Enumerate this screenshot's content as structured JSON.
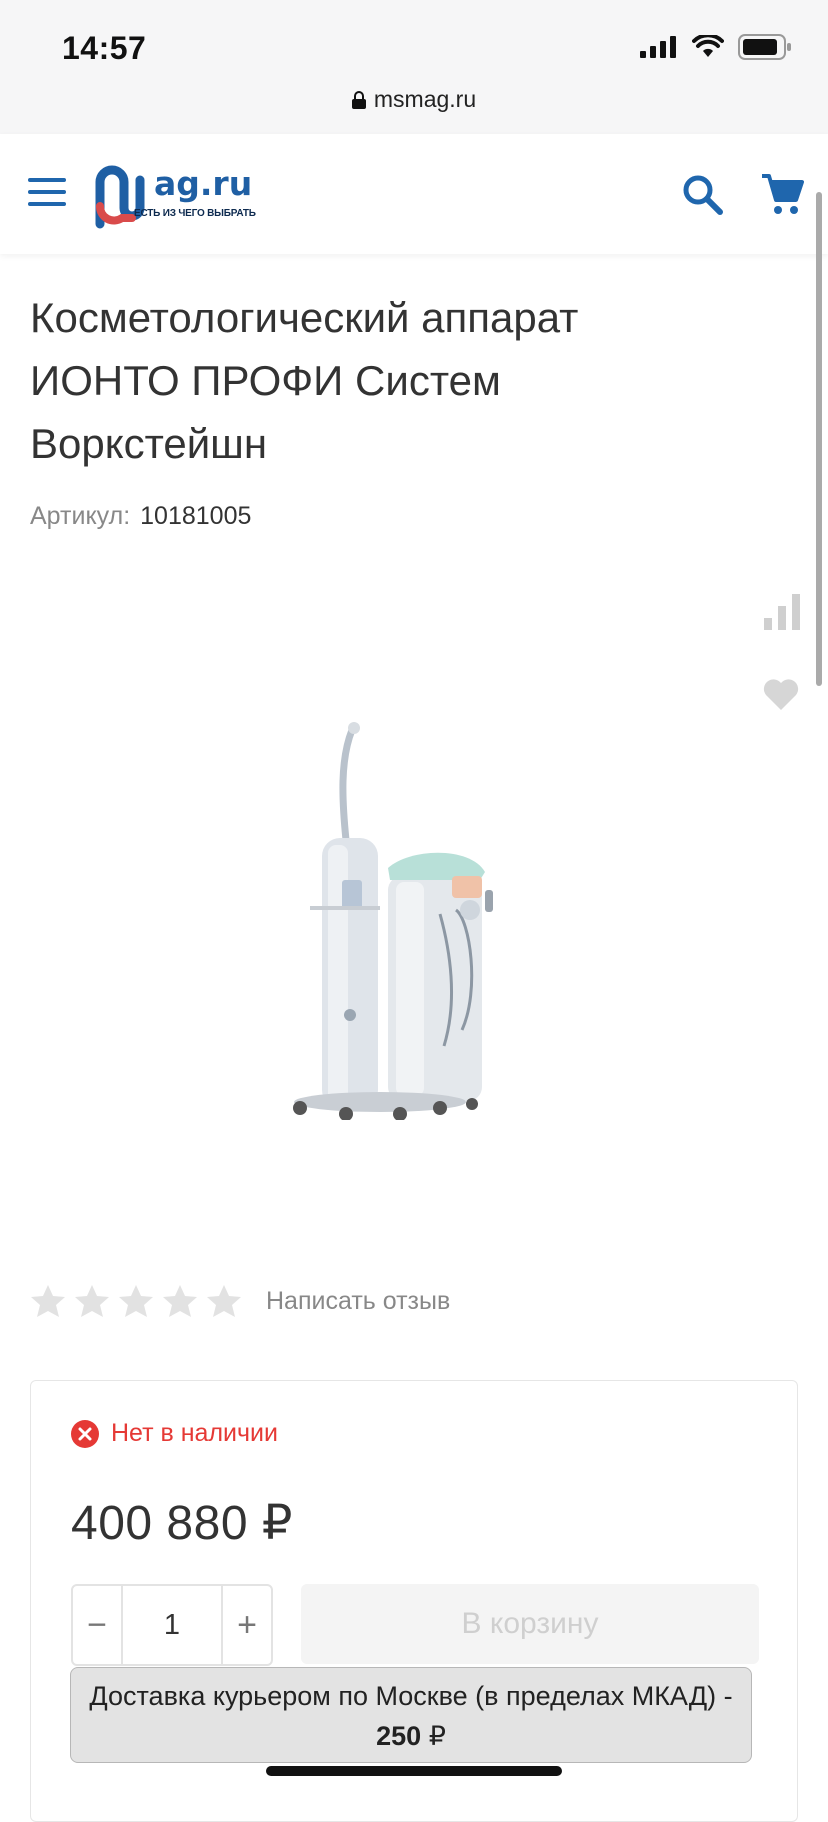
{
  "status_bar": {
    "time": "14:57"
  },
  "browser": {
    "url": "msmag.ru"
  },
  "header": {
    "logo_main": "ag.ru",
    "logo_sub": "ЕСТЬ ИЗ ЧЕГО ВЫБРАТЬ",
    "accent_color": "#1f66ad"
  },
  "product": {
    "title": "Косметологический аппарат ИОНТО ПРОФИ Систем Воркстейшн",
    "sku_label": "Артикул:",
    "sku_value": "10181005",
    "rating_stars": 0,
    "rating_max": 5,
    "review_link": "Написать отзыв"
  },
  "purchase": {
    "stock_status": "Нет в наличии",
    "stock_color": "#e53935",
    "price": "400 880 ₽",
    "quantity": "1",
    "minus_label": "−",
    "plus_label": "+",
    "add_to_cart": "В корзину"
  },
  "delivery": {
    "text": "Доставка курьером по Москве (в пределах МКАД) -",
    "price": "250",
    "currency": "₽"
  },
  "icons": [
    "menu-icon",
    "search-icon",
    "cart-icon",
    "compare-icon",
    "heart-icon",
    "star-icon",
    "close-circle-icon",
    "lock-icon"
  ]
}
